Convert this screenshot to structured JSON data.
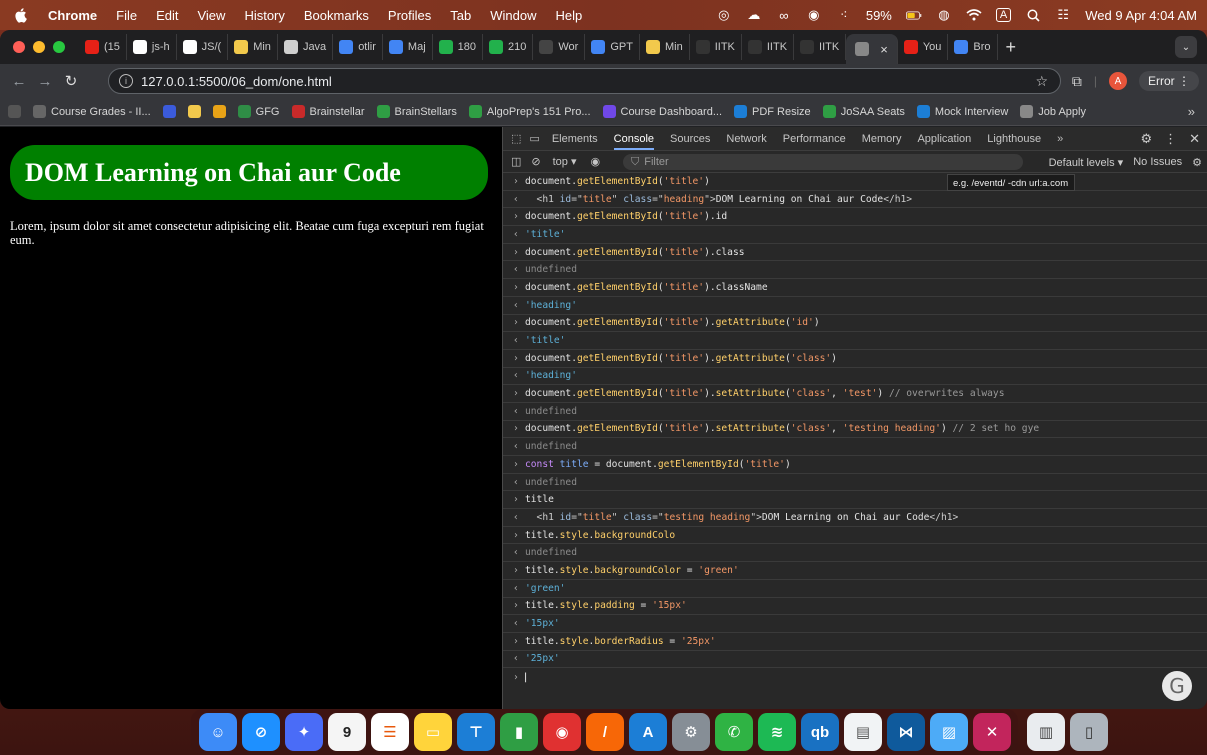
{
  "menubar": {
    "app": "Chrome",
    "items": [
      "File",
      "Edit",
      "View",
      "History",
      "Bookmarks",
      "Profiles",
      "Tab",
      "Window",
      "Help"
    ],
    "battery": "59%",
    "datetime": "Wed 9 Apr  4:04 AM",
    "input_badge": "A"
  },
  "tabs": [
    {
      "label": "(15",
      "icon": "youtube-icon",
      "color": "#e62117"
    },
    {
      "label": "js-h",
      "icon": "github-icon",
      "color": "#ffffff"
    },
    {
      "label": "JS/(",
      "icon": "github-icon",
      "color": "#ffffff"
    },
    {
      "label": "Min",
      "icon": "dev-icon",
      "color": "#f2c94c"
    },
    {
      "label": "Java",
      "icon": "w3-icon",
      "color": "#cfcfcf"
    },
    {
      "label": "otlir",
      "icon": "docs-icon",
      "color": "#4285f4"
    },
    {
      "label": "Maj",
      "icon": "docs-icon",
      "color": "#4285f4"
    },
    {
      "label": "180",
      "icon": "smiley-icon",
      "color": "#22b14c"
    },
    {
      "label": "210",
      "icon": "smiley-icon",
      "color": "#22b14c"
    },
    {
      "label": "Wor",
      "icon": "word-w-icon",
      "color": "#444"
    },
    {
      "label": "GPT",
      "icon": "docs-icon",
      "color": "#4285f4"
    },
    {
      "label": "Min",
      "icon": "dev-icon",
      "color": "#f2c94c"
    },
    {
      "label": "IITK",
      "icon": "iitk-icon",
      "color": "#333"
    },
    {
      "label": "IITK",
      "icon": "iitk-icon",
      "color": "#333"
    },
    {
      "label": "IITK",
      "icon": "iitk-icon",
      "color": "#333"
    },
    {
      "label": "",
      "icon": "globe-icon",
      "color": "#888",
      "active": true
    },
    {
      "label": "You",
      "icon": "youtube-icon",
      "color": "#e62117"
    },
    {
      "label": "Bro",
      "icon": "docs-icon",
      "color": "#4285f4"
    }
  ],
  "toolbar": {
    "url": "127.0.0.1:5500/06_dom/one.html",
    "error_label": "Error",
    "avatar_letter": "A"
  },
  "bookmarks": [
    {
      "label": "",
      "icon": "apps-grid-icon",
      "color": "#555"
    },
    {
      "label": "Course Grades - II...",
      "icon": "globe-icon",
      "color": "#666"
    },
    {
      "label": "",
      "icon": "k-icon",
      "color": "#3b5bdb"
    },
    {
      "label": "",
      "icon": "dev-icon",
      "color": "#f2c94c"
    },
    {
      "label": "",
      "icon": "bars-icon",
      "color": "#e8a317"
    },
    {
      "label": "GFG",
      "icon": "gfg-icon",
      "color": "#2f8d46"
    },
    {
      "label": "Brainstellar",
      "icon": "star-icon",
      "color": "#c92a2a"
    },
    {
      "label": "BrainStellars",
      "icon": "cross-icon",
      "color": "#2f9e44"
    },
    {
      "label": "AlgoPrep's 151 Pro...",
      "icon": "cross-icon",
      "color": "#2f9e44"
    },
    {
      "label": "Course Dashboard...",
      "icon": "hat-icon",
      "color": "#7048e8"
    },
    {
      "label": "PDF Resize",
      "icon": "circle-icon",
      "color": "#1c7ed6"
    },
    {
      "label": "JoSAA Seats",
      "icon": "cross-icon",
      "color": "#2f9e44"
    },
    {
      "label": "Mock Interview",
      "icon": "arrows-icon",
      "color": "#1c7ed6"
    },
    {
      "label": "Job Apply",
      "icon": "folder-icon",
      "color": "#888"
    }
  ],
  "page": {
    "heading": "DOM Learning on Chai aur Code",
    "paragraph": "Lorem, ipsum dolor sit amet consectetur adipisicing elit. Beatae cum fuga excepturi rem fugiat eum."
  },
  "devtools": {
    "tabs": [
      "Elements",
      "Console",
      "Sources",
      "Network",
      "Performance",
      "Memory",
      "Application",
      "Lighthouse"
    ],
    "active_tab": "Console",
    "context": "top",
    "filter_placeholder": "Filter",
    "levels": "Default levels",
    "issues": "No Issues",
    "filter_hint": "e.g. /eventd/ -cdn url:a.com"
  },
  "console_lines": [
    {
      "kind": "in",
      "parts": [
        [
          "document.",
          ""
        ],
        [
          "getElementById",
          "m"
        ],
        [
          "(",
          ""
        ],
        [
          "'title'",
          "s"
        ],
        [
          ")",
          ""
        ]
      ]
    },
    {
      "kind": "out",
      "parts": [
        [
          "  <h1 ",
          "tg"
        ],
        [
          "id",
          "ta"
        ],
        [
          "=\"",
          "tg"
        ],
        [
          "title",
          "tv"
        ],
        [
          "\" ",
          "tg"
        ],
        [
          "class",
          "ta"
        ],
        [
          "=\"",
          "tg"
        ],
        [
          "heading",
          "tv"
        ],
        [
          "\">",
          "tg"
        ],
        [
          "DOM Learning on Chai aur Code",
          ""
        ],
        [
          "</h1>",
          "tg"
        ]
      ]
    },
    {
      "kind": "in",
      "parts": [
        [
          "document.",
          ""
        ],
        [
          "getElementById",
          "m"
        ],
        [
          "(",
          ""
        ],
        [
          "'title'",
          "s"
        ],
        [
          ").id",
          ""
        ]
      ]
    },
    {
      "kind": "res",
      "parts": [
        [
          "'title'",
          "rs"
        ]
      ]
    },
    {
      "kind": "in",
      "parts": [
        [
          "document.",
          ""
        ],
        [
          "getElementById",
          "m"
        ],
        [
          "(",
          ""
        ],
        [
          "'title'",
          "s"
        ],
        [
          ").class",
          ""
        ]
      ]
    },
    {
      "kind": "res",
      "parts": [
        [
          "undefined",
          "ud"
        ]
      ]
    },
    {
      "kind": "in",
      "parts": [
        [
          "document.",
          ""
        ],
        [
          "getElementById",
          "m"
        ],
        [
          "(",
          ""
        ],
        [
          "'title'",
          "s"
        ],
        [
          ").className",
          ""
        ]
      ]
    },
    {
      "kind": "res",
      "parts": [
        [
          "'heading'",
          "rs"
        ]
      ]
    },
    {
      "kind": "in",
      "parts": [
        [
          "document.",
          ""
        ],
        [
          "getElementById",
          "m"
        ],
        [
          "(",
          ""
        ],
        [
          "'title'",
          "s"
        ],
        [
          ").",
          ""
        ],
        [
          "getAttribute",
          "m"
        ],
        [
          "(",
          ""
        ],
        [
          "'id'",
          "s"
        ],
        [
          ")",
          ""
        ]
      ]
    },
    {
      "kind": "res",
      "parts": [
        [
          "'title'",
          "rs"
        ]
      ]
    },
    {
      "kind": "in",
      "parts": [
        [
          "document.",
          ""
        ],
        [
          "getElementById",
          "m"
        ],
        [
          "(",
          ""
        ],
        [
          "'title'",
          "s"
        ],
        [
          ").",
          ""
        ],
        [
          "getAttribute",
          "m"
        ],
        [
          "(",
          ""
        ],
        [
          "'class'",
          "s"
        ],
        [
          ")",
          ""
        ]
      ]
    },
    {
      "kind": "res",
      "parts": [
        [
          "'heading'",
          "rs"
        ]
      ]
    },
    {
      "kind": "in",
      "parts": [
        [
          "document.",
          ""
        ],
        [
          "getElementById",
          "m"
        ],
        [
          "(",
          ""
        ],
        [
          "'title'",
          "s"
        ],
        [
          ").",
          ""
        ],
        [
          "setAttribute",
          "m"
        ],
        [
          "(",
          ""
        ],
        [
          "'class'",
          "s"
        ],
        [
          ", ",
          ""
        ],
        [
          "'test'",
          "s"
        ],
        [
          ") ",
          ""
        ],
        [
          "// overwrites always",
          "c"
        ]
      ]
    },
    {
      "kind": "res",
      "parts": [
        [
          "undefined",
          "ud"
        ]
      ]
    },
    {
      "kind": "in",
      "parts": [
        [
          "document.",
          ""
        ],
        [
          "getElementById",
          "m"
        ],
        [
          "(",
          ""
        ],
        [
          "'title'",
          "s"
        ],
        [
          ").",
          ""
        ],
        [
          "setAttribute",
          "m"
        ],
        [
          "(",
          ""
        ],
        [
          "'class'",
          "s"
        ],
        [
          ", ",
          ""
        ],
        [
          "'testing heading'",
          "s"
        ],
        [
          ") ",
          ""
        ],
        [
          "// 2 set ho gye",
          "c"
        ]
      ]
    },
    {
      "kind": "res",
      "parts": [
        [
          "undefined",
          "ud"
        ]
      ]
    },
    {
      "kind": "in",
      "parts": [
        [
          "const ",
          "k"
        ],
        [
          "title",
          "p"
        ],
        [
          " = document.",
          ""
        ],
        [
          "getElementById",
          "m"
        ],
        [
          "(",
          ""
        ],
        [
          "'title'",
          "s"
        ],
        [
          ")",
          ""
        ]
      ]
    },
    {
      "kind": "res",
      "parts": [
        [
          "undefined",
          "ud"
        ]
      ]
    },
    {
      "kind": "in",
      "parts": [
        [
          "title",
          ""
        ]
      ]
    },
    {
      "kind": "out",
      "parts": [
        [
          "  <h1 ",
          "tg"
        ],
        [
          "id",
          "ta"
        ],
        [
          "=\"",
          "tg"
        ],
        [
          "title",
          "tv"
        ],
        [
          "\" ",
          "tg"
        ],
        [
          "class",
          "ta"
        ],
        [
          "=\"",
          "tg"
        ],
        [
          "testing heading",
          "tv"
        ],
        [
          "\">",
          "tg"
        ],
        [
          "DOM Learning on Chai aur Code",
          ""
        ],
        [
          "</h1>",
          "tg"
        ]
      ]
    },
    {
      "kind": "in",
      "parts": [
        [
          "title.",
          ""
        ],
        [
          "style",
          "m"
        ],
        [
          ".",
          ""
        ],
        [
          "backgroundColo",
          "m"
        ]
      ]
    },
    {
      "kind": "res",
      "parts": [
        [
          "undefined",
          "ud"
        ]
      ]
    },
    {
      "kind": "in",
      "parts": [
        [
          "title.",
          ""
        ],
        [
          "style",
          "m"
        ],
        [
          ".",
          ""
        ],
        [
          "backgroundColor",
          "m"
        ],
        [
          " = ",
          ""
        ],
        [
          "'green'",
          "s"
        ]
      ]
    },
    {
      "kind": "res",
      "parts": [
        [
          "'green'",
          "rs"
        ]
      ]
    },
    {
      "kind": "in",
      "parts": [
        [
          "title.",
          ""
        ],
        [
          "style",
          "m"
        ],
        [
          ".",
          ""
        ],
        [
          "padding",
          "m"
        ],
        [
          " = ",
          ""
        ],
        [
          "'15px'",
          "s"
        ]
      ]
    },
    {
      "kind": "res",
      "parts": [
        [
          "'15px'",
          "rs"
        ]
      ]
    },
    {
      "kind": "in",
      "parts": [
        [
          "title.",
          ""
        ],
        [
          "style",
          "m"
        ],
        [
          ".",
          ""
        ],
        [
          "borderRadius",
          "m"
        ],
        [
          " = ",
          ""
        ],
        [
          "'25px'",
          "s"
        ]
      ]
    },
    {
      "kind": "res",
      "parts": [
        [
          "'25px'",
          "rs"
        ]
      ]
    }
  ],
  "dock": [
    {
      "name": "finder-icon",
      "color": "#3d8bf7",
      "glyph": "☺"
    },
    {
      "name": "safari-icon",
      "color": "#1e90ff",
      "glyph": "⊘"
    },
    {
      "name": "launchpad-icon",
      "color": "#4a6cf7",
      "glyph": "✦"
    },
    {
      "name": "calendar-icon",
      "color": "#f5f5f5",
      "glyph": "9",
      "text": "#222"
    },
    {
      "name": "reminders-icon",
      "color": "#ffffff",
      "glyph": "☰",
      "text": "#e8590c"
    },
    {
      "name": "notes-icon",
      "color": "#ffd43b",
      "glyph": "▭"
    },
    {
      "name": "keynote-icon",
      "color": "#1c7ed6",
      "glyph": "⊤"
    },
    {
      "name": "numbers-icon",
      "color": "#2f9e44",
      "glyph": "▮"
    },
    {
      "name": "chrome-icon",
      "color": "#e03131",
      "glyph": "◉"
    },
    {
      "name": "sublime-icon",
      "color": "#f76707",
      "glyph": "/"
    },
    {
      "name": "app-store-icon",
      "color": "#1c7ed6",
      "glyph": "A"
    },
    {
      "name": "settings-icon",
      "color": "#868e96",
      "glyph": "⚙"
    },
    {
      "name": "whatsapp-icon",
      "color": "#2fb344",
      "glyph": "✆"
    },
    {
      "name": "spotify-icon",
      "color": "#1db954",
      "glyph": "≋"
    },
    {
      "name": "qbittorrent-icon",
      "color": "#1971c2",
      "glyph": "qb"
    },
    {
      "name": "document-icon",
      "color": "#f1f3f5",
      "glyph": "▤",
      "text": "#555"
    },
    {
      "name": "vscode-icon",
      "color": "#0f5a9c",
      "glyph": "⋈"
    },
    {
      "name": "preview-icon",
      "color": "#4dabf7",
      "glyph": "▨"
    },
    {
      "name": "xcode-icon",
      "color": "#c2255c",
      "glyph": "✕"
    },
    {
      "name": "separator",
      "color": ""
    },
    {
      "name": "downloads-stack-icon",
      "color": "#e9ecef",
      "glyph": "▥",
      "text": "#444"
    },
    {
      "name": "trash-icon",
      "color": "#adb5bd",
      "glyph": "▯",
      "text": "#333"
    }
  ]
}
